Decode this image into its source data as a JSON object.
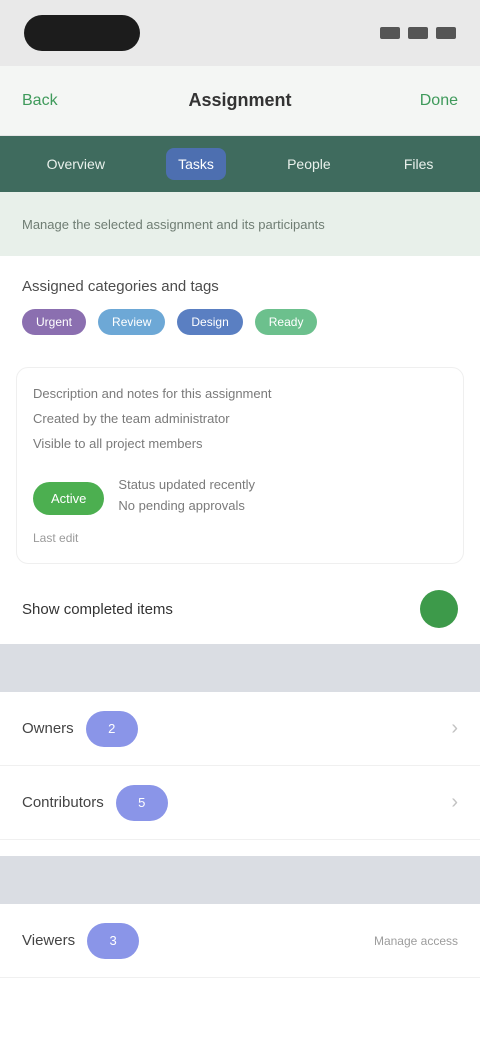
{
  "status_bar": {
    "pill": "",
    "icons": [
      "signal-icon",
      "wifi-icon",
      "battery-icon"
    ]
  },
  "header": {
    "left": "Back",
    "title": "Assignment",
    "right": "Done"
  },
  "tabs": [
    {
      "label": "Overview"
    },
    {
      "label": "Tasks"
    },
    {
      "label": "People"
    },
    {
      "label": "Files"
    }
  ],
  "subheader": "Manage the selected assignment and its participants",
  "section": {
    "title": "Assigned categories and tags",
    "chips": [
      {
        "label": "Urgent",
        "color": "#8b6fb0"
      },
      {
        "label": "Review",
        "color": "#6da8d6"
      },
      {
        "label": "Design",
        "color": "#5a7fc2"
      },
      {
        "label": "Ready",
        "color": "#6cc08d"
      }
    ]
  },
  "card": {
    "line1": "Description and notes for this assignment",
    "line2": "Created by the team administrator",
    "line3": "Visible to all project members",
    "badge": "Active",
    "row_text1": "Status updated recently",
    "row_text2": "No pending approvals",
    "foot": "Last edit"
  },
  "toggle": {
    "label": "Show completed items"
  },
  "group1": [
    {
      "label": "Owners",
      "count": "2"
    },
    {
      "label": "Contributors",
      "count": "5"
    }
  ],
  "group2": [
    {
      "label": "Viewers",
      "count": "3",
      "right": "Manage access"
    }
  ]
}
